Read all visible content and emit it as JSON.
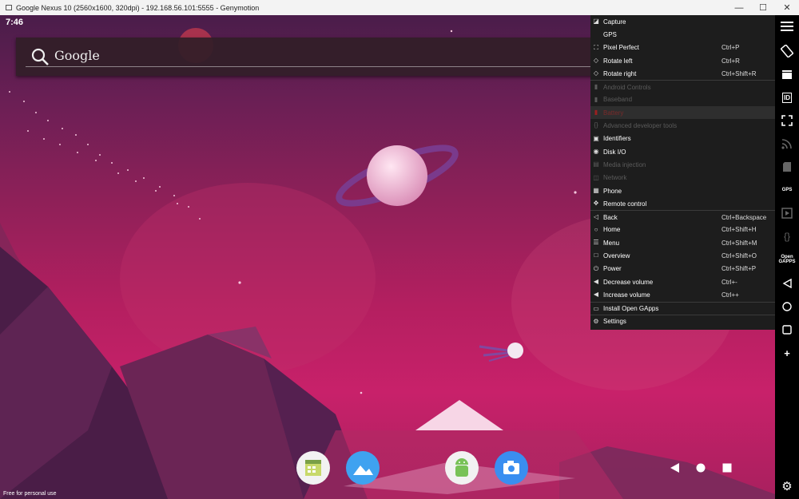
{
  "window": {
    "title": "Google Nexus 10 (2560x1600, 320dpi) - 192.168.56.101:5555 - Genymotion",
    "minimize": "—",
    "maximize": "☐",
    "close": "✕"
  },
  "android": {
    "clock": "7:46",
    "search_label": "Google",
    "watermark": "Free for personal use"
  },
  "menu": {
    "items": [
      {
        "label": "Capture",
        "shortcut": "",
        "icon": "capture-icon",
        "state": "normal"
      },
      {
        "label": "GPS",
        "shortcut": "",
        "icon": "gps-icon",
        "state": "normal"
      },
      {
        "label": "Pixel Perfect",
        "shortcut": "Ctrl+P",
        "icon": "pixel-perfect-icon",
        "state": "normal"
      },
      {
        "label": "Rotate left",
        "shortcut": "Ctrl+R",
        "icon": "rotate-left-icon",
        "state": "normal"
      },
      {
        "label": "Rotate right",
        "shortcut": "Ctrl+Shift+R",
        "icon": "rotate-right-icon",
        "state": "normal"
      },
      {
        "label": "Android Controls",
        "shortcut": "",
        "icon": "android-controls-icon",
        "state": "disabled"
      },
      {
        "label": "Baseband",
        "shortcut": "",
        "icon": "baseband-icon",
        "state": "disabled"
      },
      {
        "label": "Battery",
        "shortcut": "",
        "icon": "battery-icon",
        "state": "highlight"
      },
      {
        "label": "Advanced developer tools",
        "shortcut": "",
        "icon": "developer-tools-icon",
        "state": "disabled"
      },
      {
        "label": "Identifiers",
        "shortcut": "",
        "icon": "identifiers-icon",
        "state": "normal"
      },
      {
        "label": "Disk I/O",
        "shortcut": "",
        "icon": "disk-io-icon",
        "state": "normal"
      },
      {
        "label": "Media injection",
        "shortcut": "",
        "icon": "media-injection-icon",
        "state": "disabled"
      },
      {
        "label": "Network",
        "shortcut": "",
        "icon": "network-icon",
        "state": "disabled"
      },
      {
        "label": "Phone",
        "shortcut": "",
        "icon": "phone-icon",
        "state": "normal"
      },
      {
        "label": "Remote control",
        "shortcut": "",
        "icon": "remote-control-icon",
        "state": "normal"
      },
      {
        "label": "Back",
        "shortcut": "Ctrl+Backspace",
        "icon": "back-icon",
        "state": "normal"
      },
      {
        "label": "Home",
        "shortcut": "Ctrl+Shift+H",
        "icon": "home-icon",
        "state": "normal"
      },
      {
        "label": "Menu",
        "shortcut": "Ctrl+Shift+M",
        "icon": "menu-icon",
        "state": "normal"
      },
      {
        "label": "Overview",
        "shortcut": "Ctrl+Shift+O",
        "icon": "overview-icon",
        "state": "normal"
      },
      {
        "label": "Power",
        "shortcut": "Ctrl+Shift+P",
        "icon": "power-icon",
        "state": "normal"
      },
      {
        "label": "Decrease volume",
        "shortcut": "Ctrl+-",
        "icon": "volume-down-icon",
        "state": "normal"
      },
      {
        "label": "Increase volume",
        "shortcut": "Ctrl++",
        "icon": "volume-up-icon",
        "state": "normal"
      },
      {
        "label": "Install Open GApps",
        "shortcut": "",
        "icon": "open-gapps-icon",
        "state": "normal"
      },
      {
        "label": "Settings",
        "shortcut": "",
        "icon": "settings-icon",
        "state": "normal"
      }
    ]
  },
  "sidebar": {
    "gps_label": "GPS",
    "id_label": "ID",
    "open_gapps_label": "Open\nGAPPS",
    "add_label": "+"
  },
  "colors": {
    "menu_bg": "#1d1d1d",
    "sidebar_bg": "#000000",
    "wallpaper_accent": "#c8216a"
  }
}
